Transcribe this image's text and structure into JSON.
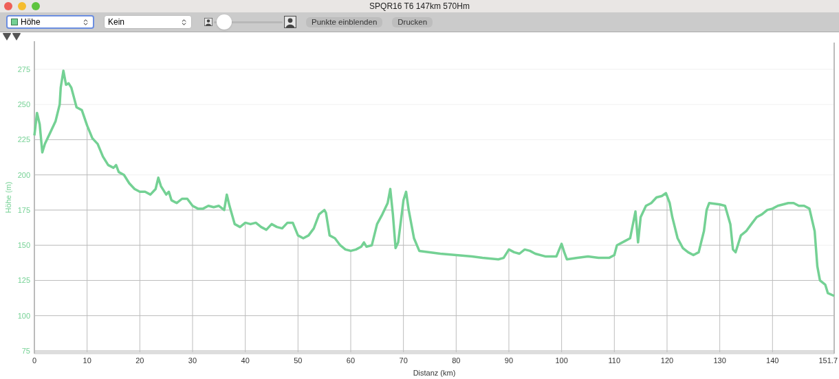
{
  "window": {
    "title": "SPQR16 T6 147km 570Hm"
  },
  "toolbar": {
    "selects": [
      {
        "kind": "series",
        "focused": true
      },
      {
        "kind": "plain",
        "value": "Kein",
        "focused": false
      }
    ],
    "zoom_slider": {
      "level": 0.05
    },
    "buttons": [
      "Punkte einblenden",
      "Drucken"
    ]
  },
  "chart_data": {
    "type": "line",
    "xlabel": "Distanz (km)",
    "ylabel": "Höhe (m)",
    "x": [
      0,
      0.5,
      1,
      1.5,
      2,
      3,
      4,
      4.8,
      5,
      5.5,
      6,
      6.5,
      7,
      7.5,
      8,
      9,
      10,
      11,
      12,
      13,
      14,
      15,
      15.5,
      16,
      17,
      18,
      19,
      20,
      21,
      22,
      23,
      23.5,
      24,
      25,
      25.5,
      26,
      27,
      28,
      29,
      30,
      31,
      32,
      33,
      34,
      35,
      36,
      36.5,
      37,
      38,
      39,
      40,
      41,
      42,
      43,
      44,
      45,
      46,
      47,
      48,
      49,
      50,
      51,
      52,
      53,
      54,
      55,
      55.3,
      56,
      57,
      58,
      59,
      60,
      61,
      62,
      62.5,
      63,
      64,
      65,
      66,
      67,
      67.5,
      68,
      68.5,
      69,
      70,
      70.5,
      71,
      72,
      73,
      75,
      77,
      80,
      83,
      85,
      88,
      89,
      90,
      91,
      92,
      93,
      94,
      95,
      97,
      99,
      100,
      100.5,
      101,
      103,
      105,
      107,
      109,
      110,
      110.5,
      112,
      113,
      114,
      114.5,
      115,
      116,
      117,
      118,
      119,
      119.8,
      120.5,
      121,
      122,
      123,
      124,
      125,
      126,
      127,
      127.5,
      128,
      130,
      131,
      132,
      132.5,
      133,
      134,
      135,
      136,
      137,
      138,
      139,
      140,
      141,
      143,
      144,
      145,
      146,
      147,
      148,
      148.5,
      149,
      150,
      150.5,
      151.7
    ],
    "series": [
      {
        "name": "Höhe",
        "color": "#74d194",
        "values": [
          228,
          244,
          236,
          216,
          222,
          230,
          238,
          250,
          262,
          274,
          264,
          265,
          262,
          255,
          248,
          246,
          235,
          226,
          222,
          213,
          207,
          205,
          207,
          202,
          200,
          194,
          190,
          188,
          188,
          186,
          190,
          198,
          192,
          186,
          188,
          182,
          180,
          183,
          183,
          178,
          176,
          176,
          178,
          177,
          178,
          175,
          186,
          178,
          165,
          163,
          166,
          165,
          166,
          163,
          161,
          165,
          163,
          162,
          166,
          166,
          157,
          155,
          157,
          162,
          172,
          175,
          173,
          157,
          155,
          150,
          147,
          146,
          147,
          149,
          152,
          149,
          150,
          165,
          172,
          180,
          190,
          172,
          148,
          152,
          182,
          188,
          175,
          155,
          146,
          145,
          144,
          143,
          142,
          141,
          140,
          141,
          147,
          145,
          144,
          147,
          146,
          144,
          142,
          142,
          151,
          145,
          140,
          141,
          142,
          141,
          141,
          143,
          150,
          153,
          155,
          174,
          152,
          170,
          178,
          180,
          184,
          185,
          187,
          180,
          170,
          155,
          148,
          145,
          143,
          145,
          160,
          175,
          180,
          179,
          178,
          165,
          147,
          145,
          157,
          160,
          165,
          170,
          172,
          175,
          176,
          178,
          180,
          180,
          178,
          178,
          176,
          160,
          135,
          125,
          122,
          116,
          114
        ]
      }
    ],
    "grid": true,
    "xlim": [
      0,
      151.7
    ],
    "ylim": [
      74,
      294
    ],
    "xticks": [
      0,
      10,
      20,
      30,
      40,
      50,
      60,
      70,
      80,
      90,
      100,
      110,
      120,
      130,
      140,
      151.7
    ],
    "yticks": [
      75,
      100,
      125,
      150,
      175,
      200,
      225,
      250,
      275
    ]
  }
}
